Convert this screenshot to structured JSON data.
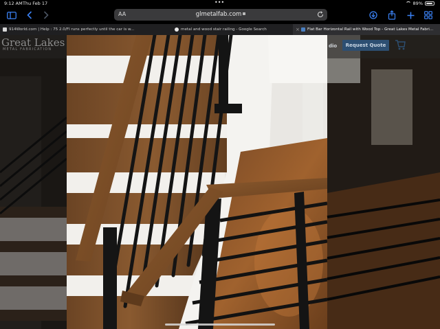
{
  "status_bar": {
    "time": "9:12 AM",
    "date": "Thu Feb 17",
    "battery_percent": "89%",
    "battery_level": 0.89
  },
  "toolbar": {
    "reader_label": "AA",
    "url": "glmetalfab.com",
    "icons": [
      "sidebar-icon",
      "back-icon",
      "forward-icon",
      "download-icon",
      "share-icon",
      "new-tab-icon",
      "tab-overview-icon"
    ],
    "accent": "#3b82f6"
  },
  "tabs": [
    {
      "title": "914World.com | Help : 75 2.0/FI runs perfectly until the car is w...",
      "active": false,
      "favicon_color": "#d9d9d9"
    },
    {
      "title": "metal and wood stair railing - Google Search",
      "active": false,
      "favicon_color": "#e8e8e8"
    },
    {
      "title": "Flat Bar Horizontal Rail with Wood Top - Great Lakes Metal Fabri...",
      "active": true,
      "favicon_color": "#4a7fc1"
    }
  ],
  "site": {
    "brand_name": "Great Lakes",
    "brand_tagline": "METAL FABRICATION",
    "nav_partial": "dio",
    "cta_label": "Request Quote",
    "cta_color": "#2d4f72"
  }
}
